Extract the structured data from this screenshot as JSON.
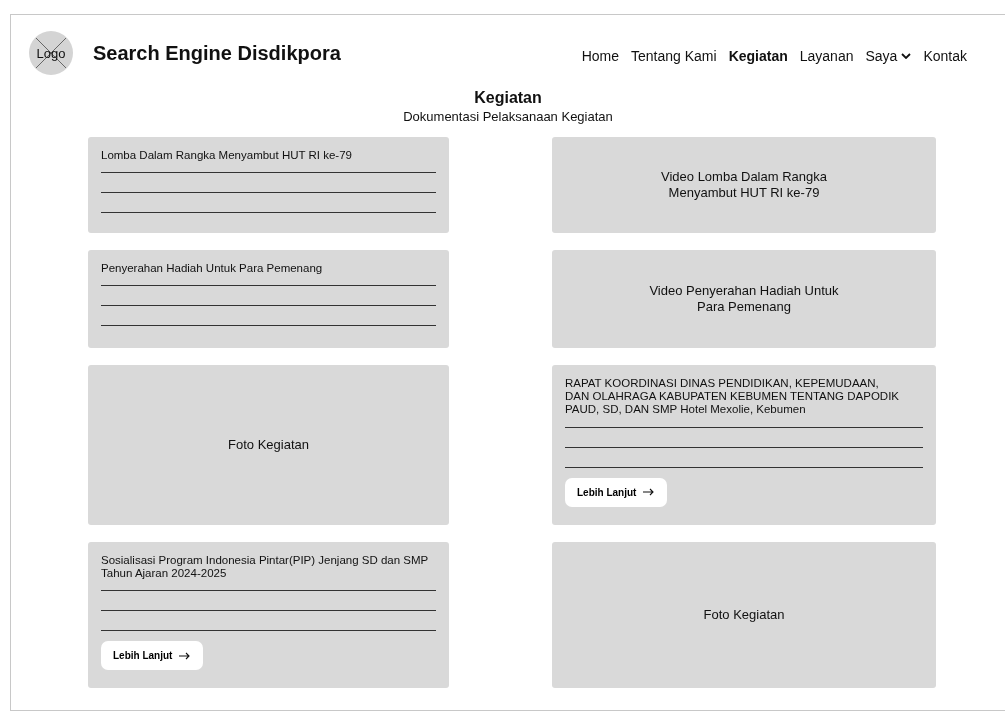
{
  "header": {
    "logo": "Logo",
    "site_title": "Search Engine Disdikpora"
  },
  "nav": [
    {
      "label": "Home",
      "selected": false,
      "has_dropdown": false
    },
    {
      "label": "Tentang Kami",
      "selected": false,
      "has_dropdown": false
    },
    {
      "label": "Kegiatan",
      "selected": true,
      "has_dropdown": false
    },
    {
      "label": "Layanan",
      "selected": false,
      "has_dropdown": false
    },
    {
      "label": "Saya",
      "selected": false,
      "has_dropdown": true
    },
    {
      "label": "Kontak",
      "selected": false,
      "has_dropdown": false
    }
  ],
  "page": {
    "title": "Kegiatan",
    "subtitle": "Dokumentasi Pelaksanaan Kegiatan"
  },
  "cards": [
    {
      "kind": "text",
      "title": "Lomba Dalam Rangka Menyambut HUT RI ke-79"
    },
    {
      "kind": "video",
      "caption": "Video Lomba Dalam Rangka Menyambut HUT RI ke-79"
    },
    {
      "kind": "text",
      "title": "Penyerahan Hadiah Untuk Para Pemenang"
    },
    {
      "kind": "video",
      "caption": "Video Penyerahan Hadiah Untuk Para Pemenang"
    },
    {
      "kind": "photo",
      "caption": "Foto Kegiatan"
    },
    {
      "kind": "text",
      "title": "RAPAT KOORDINASI DINAS PENDIDIKAN, KEPEMUDAAN, DAN OLAHRAGA KABUPATEN KEBUMEN TENTANG DAPODIK PAUD, SD, DAN SMP Hotel Mexolie, Kebumen",
      "button": "Lebih Lanjut"
    },
    {
      "kind": "text",
      "title": "Sosialisasi Program Indonesia Pintar(PIP) Jenjang SD dan SMP Tahun Ajaran 2024-2025",
      "button": "Lebih Lanjut"
    },
    {
      "kind": "photo",
      "caption": "Foto Kegiatan"
    }
  ]
}
